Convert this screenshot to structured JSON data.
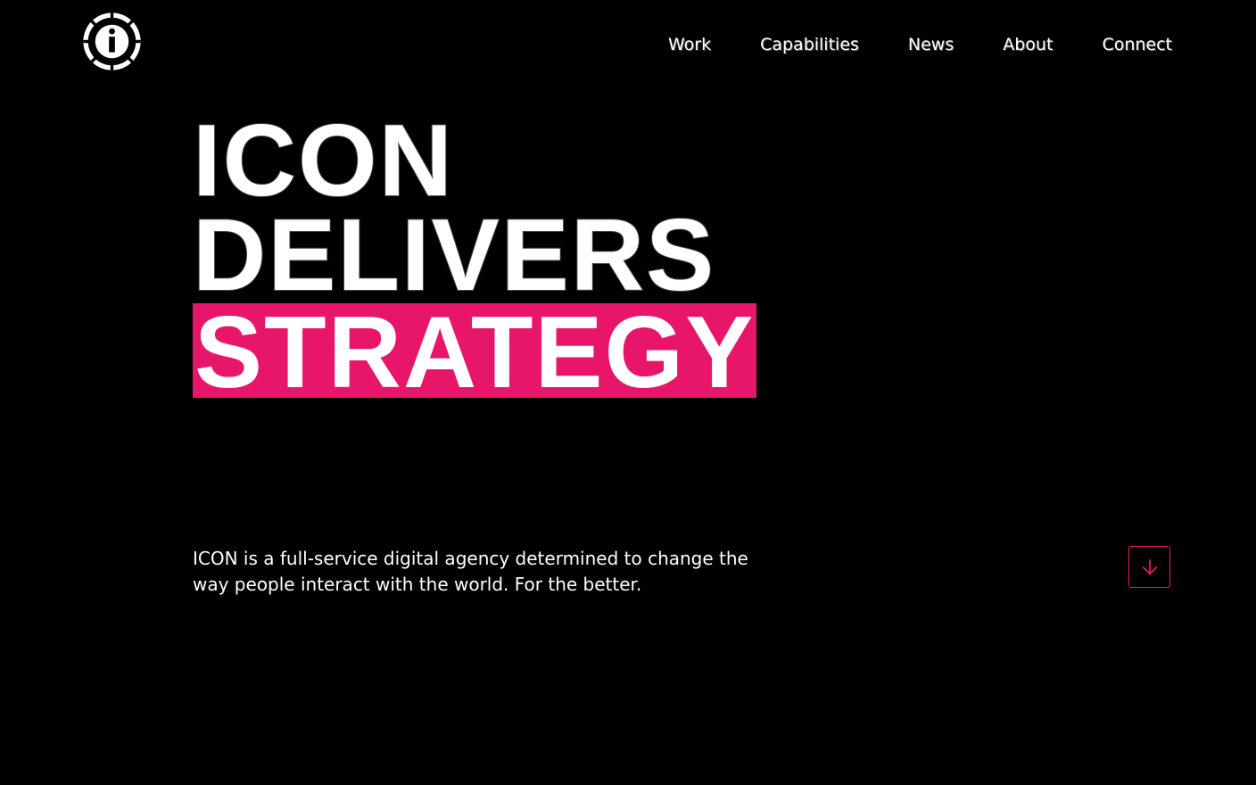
{
  "header": {
    "logo_icon": "info-badge-icon",
    "nav": {
      "work": "Work",
      "capabilities": "Capabilities",
      "news": "News",
      "about": "About",
      "connect": "Connect"
    }
  },
  "hero": {
    "line1": "ICON",
    "line2": "DELIVERS",
    "line3": "STRATEGY"
  },
  "intro": {
    "text": "ICON is a full-service digital agency determined to change the way people interact with the world. For the better."
  },
  "scroll_button": {
    "icon": "arrow-down-icon"
  },
  "colors": {
    "background": "#000000",
    "accent": "#e8166a",
    "text": "#ffffff"
  }
}
